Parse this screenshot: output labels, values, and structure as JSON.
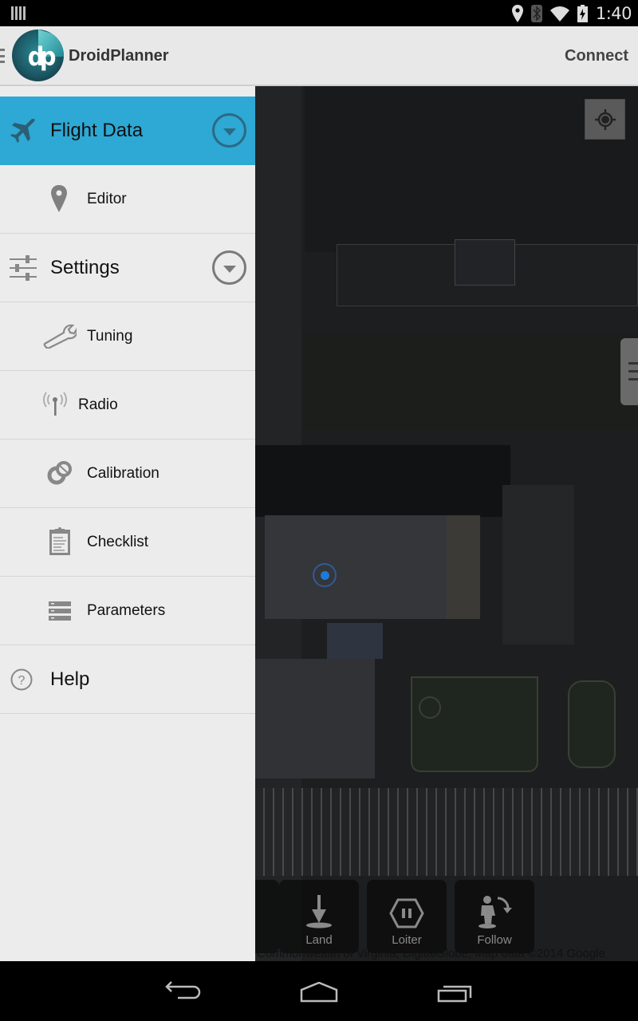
{
  "status_bar": {
    "time": "1:40",
    "icons": [
      "notification-icon",
      "location-icon",
      "bluetooth-icon",
      "wifi-icon",
      "battery-charging-icon"
    ]
  },
  "action_bar": {
    "app_title": "DroidPlanner",
    "connect_label": "Connect",
    "logo_letters": "dp"
  },
  "drawer": {
    "items": [
      {
        "label": "Flight Data",
        "icon": "airplane-icon",
        "type": "group",
        "active": true,
        "expandable": true
      },
      {
        "label": "Editor",
        "icon": "map-pin-icon",
        "type": "sub"
      },
      {
        "label": "Settings",
        "icon": "sliders-icon",
        "type": "group",
        "expandable": true
      },
      {
        "label": "Tuning",
        "icon": "wrench-icon",
        "type": "sub"
      },
      {
        "label": "Radio",
        "icon": "antenna-icon",
        "type": "sub"
      },
      {
        "label": "Calibration",
        "icon": "calibration-icon",
        "type": "sub"
      },
      {
        "label": "Checklist",
        "icon": "clipboard-icon",
        "type": "sub"
      },
      {
        "label": "Parameters",
        "icon": "parameters-icon",
        "type": "sub"
      },
      {
        "label": "Help",
        "icon": "help-icon",
        "type": "group"
      }
    ]
  },
  "map": {
    "attribution": "Commonwealth of Virginia, DigitalGlobe, Map data ©2014 Google",
    "mode_buttons": [
      {
        "label": "Land",
        "icon": "land-icon"
      },
      {
        "label": "Loiter",
        "icon": "loiter-icon"
      },
      {
        "label": "Follow",
        "icon": "follow-icon"
      }
    ]
  },
  "colors": {
    "accent": "#2ea8d4",
    "drawer_bg": "#ececec",
    "action_bar_bg": "#e8e8e8",
    "drone_marker": "#1e7ad8"
  }
}
